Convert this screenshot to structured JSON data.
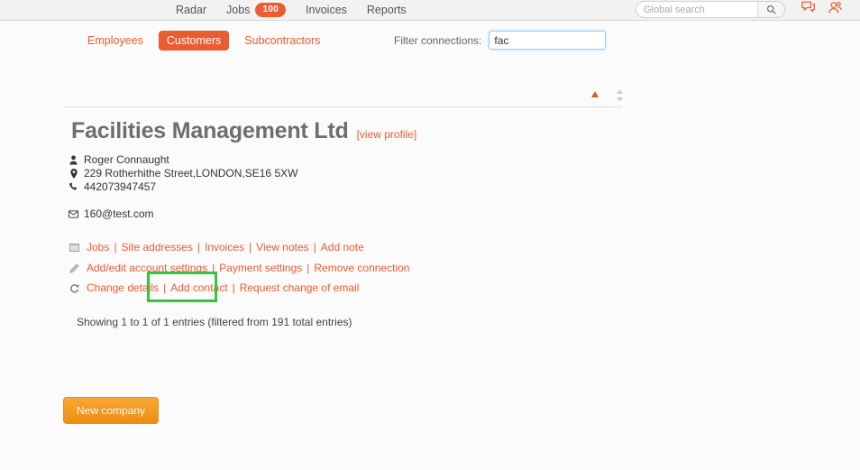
{
  "topbar": {
    "nav": [
      {
        "label": "Radar",
        "name": "nav-radar"
      },
      {
        "label": "Jobs",
        "name": "nav-jobs",
        "badge": "100"
      },
      {
        "label": "Invoices",
        "name": "nav-invoices"
      },
      {
        "label": "Reports",
        "name": "nav-reports"
      }
    ],
    "nav_radar": "Radar",
    "nav_jobs": "Jobs",
    "nav_jobs_badge": "100",
    "nav_invoices": "Invoices",
    "nav_reports": "Reports",
    "search_placeholder": "Global search",
    "search_value": "",
    "search_icon": "search-icon",
    "chat_icon": "chat-bubbles-icon",
    "account_icon": "user-account-icon",
    "accent_color": "#ec5c32"
  },
  "subtabs": {
    "employees": "Employees",
    "customers": "Customers",
    "subcontractors": "Subcontractors",
    "active": "Customers"
  },
  "filter": {
    "label": "Filter connections:",
    "value": "fac",
    "placeholder": ""
  },
  "sort": {
    "asc_icon": "sort-ascending-icon",
    "both_icon": "sort-both-icon"
  },
  "company": {
    "name": "Facilities Management Ltd",
    "view_profile": "[view profile]",
    "contact_name": "Roger Connaught",
    "address": "229 Rotherhithe Street,LONDON,SE16 5XW",
    "phone": "442073947457",
    "email": "160@test.com",
    "person_icon": "person-icon",
    "location_icon": "map-pin-icon",
    "phone_icon": "phone-icon",
    "email_icon": "envelope-icon"
  },
  "links": {
    "row1_icon": "list-table-icon",
    "row1": [
      {
        "label": "Jobs",
        "name": "link-jobs"
      },
      {
        "label": "Site addresses",
        "name": "link-site-addresses"
      },
      {
        "label": "Invoices",
        "name": "link-invoices"
      },
      {
        "label": "View notes",
        "name": "link-view-notes"
      },
      {
        "label": "Add note",
        "name": "link-add-note"
      }
    ],
    "row2_icon": "pencil-icon",
    "row2": [
      {
        "label": "Add/edit account settings",
        "name": "link-add-edit-account-settings"
      },
      {
        "label": "Payment settings",
        "name": "link-payment-settings"
      },
      {
        "label": "Remove connection",
        "name": "link-remove-connection"
      }
    ],
    "row3_icon": "refresh-icon",
    "row3": [
      {
        "label": "Change details",
        "name": "link-change-details"
      },
      {
        "label": "Add contact",
        "name": "link-add-contact"
      },
      {
        "label": "Request change of email",
        "name": "link-request-change-of-email"
      }
    ],
    "separator": "|",
    "highlighted": "Add contact",
    "highlight_color": "#36c23a"
  },
  "footer": {
    "showing": "Showing 1 to 1 of 1 entries (filtered from 191 total entries)",
    "new_company": "New company"
  }
}
